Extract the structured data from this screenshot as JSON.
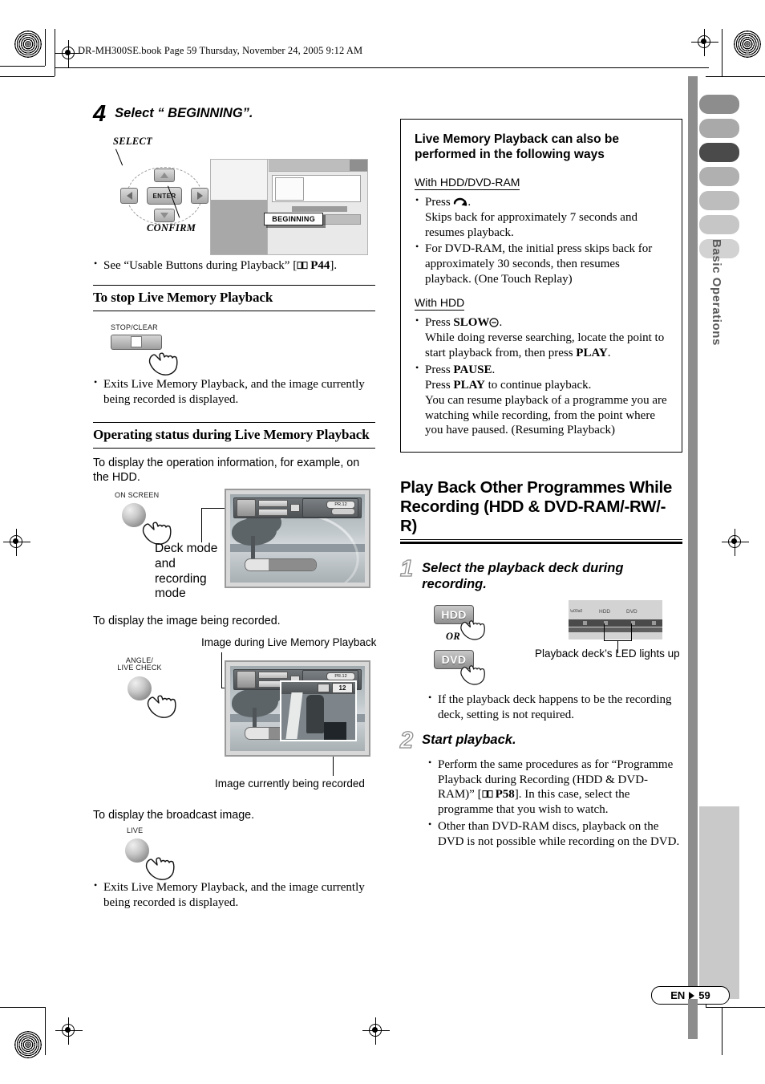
{
  "book_header": "DR-MH300SE.book  Page 59  Thursday, November 24, 2005  9:12 AM",
  "left_column": {
    "step4": {
      "number": "4",
      "title": "Select “ BEGINNING”.",
      "diagram": {
        "select_label": "SELECT",
        "confirm_label": "CONFIRM",
        "enter_key": "ENTER",
        "menu_highlight": "BEGINNING"
      },
      "bullets": [
        "See “Usable Buttons during Playback” [ P44]."
      ],
      "bullet_ref_page": "P44"
    },
    "stop_section": {
      "heading": "To stop Live Memory Playback",
      "key_label": "STOP/CLEAR",
      "bullets": [
        "Exits Live Memory Playback, and the image currently being recorded is displayed."
      ]
    },
    "status_section": {
      "heading": "Operating status during Live Memory Playback",
      "intro": "To display the operation information, for example, on the HDD.",
      "key_label": "ON SCREEN",
      "callout": "Deck mode and recording mode",
      "osd_badge": "PR.12"
    },
    "recorded_image_section": {
      "intro": "To display the image being recorded.",
      "caption_top": "Image during Live Memory Playback",
      "key_label": "ANGLE/\nLIVE CHECK",
      "key_label_line1": "ANGLE/",
      "key_label_line2": "LIVE CHECK",
      "pip_number": "12",
      "caption_bottom": "Image currently being recorded",
      "osd_badge": "PR.12"
    },
    "broadcast_section": {
      "intro": "To display the broadcast image.",
      "key_label": "LIVE",
      "bullets": [
        "Exits Live Memory Playback, and the image currently being recorded is displayed."
      ]
    }
  },
  "right_column": {
    "note_box": {
      "title": "Live Memory Playback can also be performed in the following ways",
      "groups": [
        {
          "heading": "With HDD/DVD-RAM",
          "items": [
            "Press ↶.\nSkips back for approximately 7 seconds and resumes playback.",
            "For DVD-RAM, the initial press skips back for approximately 30 seconds, then resumes playback. (One Touch Replay)"
          ]
        },
        {
          "heading": "With HDD",
          "items": [
            "Press SLOW⊝.\nWhile doing reverse searching, locate the point to start playback from, then press PLAY.",
            "Press PAUSE.\nPress PLAY to continue playback.\nYou can resume playback of a programme you are watching while recording, from the point where you have paused. (Resuming Playback)"
          ]
        }
      ]
    },
    "section_heading_line1": "Play Back Other Programmes While",
    "section_heading_line2": "Recording (HDD & DVD-RAM/-RW/-R)",
    "step1": {
      "number": "1",
      "title_line1": "Select the playback deck during",
      "title_line2": "recording.",
      "key_hdd": "HDD",
      "key_or": "OR",
      "key_dvd": "DVD",
      "panel_label_hdd": "HDD",
      "panel_label_dvd": "DVD",
      "panel_caption": "Playback deck’s LED lights up",
      "bullets": [
        "If the playback deck happens to be the recording deck, setting is not required."
      ]
    },
    "step2": {
      "number": "2",
      "title": "Start playback.",
      "bullets": [
        "Perform the same procedures as for “Programme Playback during Recording (HDD & DVD-RAM)” [ P58]. In this case, select the programme that you wish to watch.",
        "Other than DVD-RAM discs, playback on the DVD is not possible while recording on the DVD."
      ],
      "bullet_ref_page": "P58"
    }
  },
  "sidebar": {
    "vertical_label": "Basic Operations",
    "tab_colors": [
      "#8d8d8d",
      "#a9a9a9",
      "#4a4a4a",
      "#b0b0b0",
      "#bdbdbd",
      "#c6c6c6",
      "#d2d2d2"
    ]
  },
  "footer": {
    "locale": "EN",
    "page_number": "59"
  }
}
